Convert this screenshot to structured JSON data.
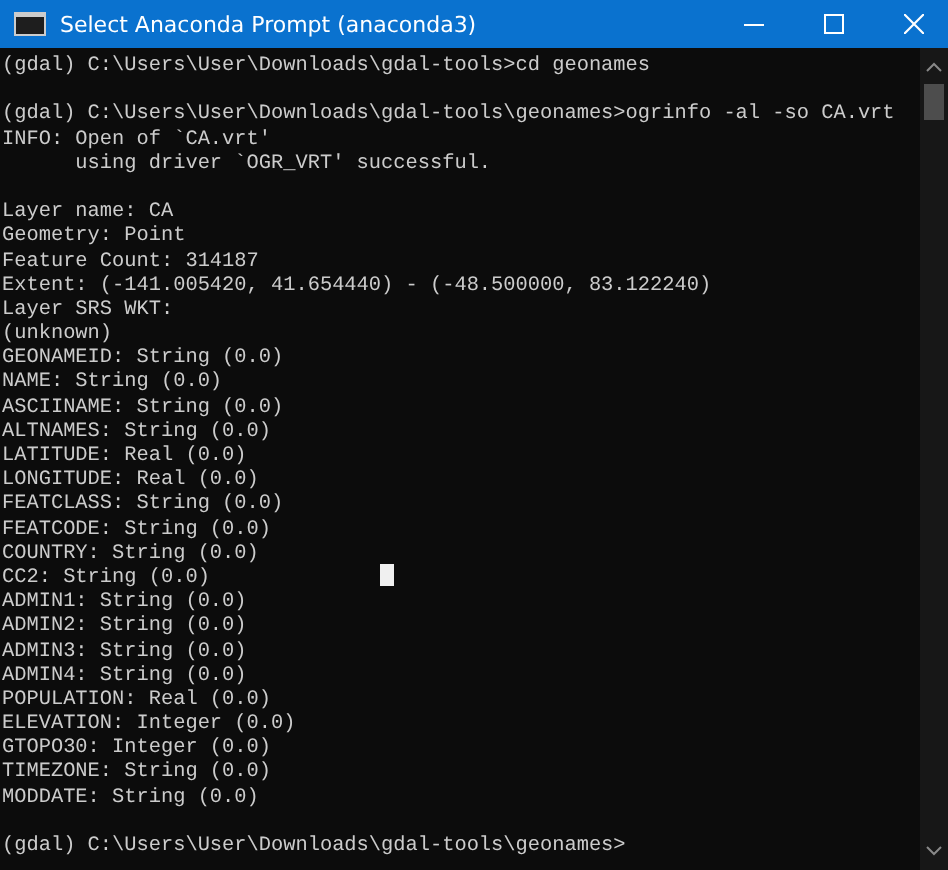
{
  "window": {
    "title": "Select Anaconda Prompt (anaconda3)"
  },
  "console": {
    "blocks": [
      {
        "lines": [
          "(gdal) C:\\Users\\User\\Downloads\\gdal-tools>cd geonames"
        ]
      },
      {
        "lines": [
          "(gdal) C:\\Users\\User\\Downloads\\gdal-tools\\geonames>ogrinfo -al -so CA.vrt",
          "INFO: Open of `CA.vrt'",
          "      using driver `OGR_VRT' successful."
        ]
      },
      {
        "lines": [
          "Layer name: CA",
          "Geometry: Point",
          "Feature Count: 314187",
          "Extent: (-141.005420, 41.654440) - (-48.500000, 83.122240)",
          "Layer SRS WKT:",
          "(unknown)",
          "GEONAMEID: String (0.0)",
          "NAME: String (0.0)",
          "ASCIINAME: String (0.0)",
          "ALTNAMES: String (0.0)",
          "LATITUDE: Real (0.0)",
          "LONGITUDE: Real (0.0)",
          "FEATCLASS: String (0.0)",
          "FEATCODE: String (0.0)",
          "COUNTRY: String (0.0)",
          "CC2: String (0.0)",
          "ADMIN1: String (0.0)",
          "ADMIN2: String (0.0)",
          "ADMIN3: String (0.0)",
          "ADMIN4: String (0.0)",
          "POPULATION: Real (0.0)",
          "ELEVATION: Integer (0.0)",
          "GTOPO30: Integer (0.0)",
          "TIMEZONE: String (0.0)",
          "MODDATE: String (0.0)"
        ]
      },
      {
        "lines": [
          "(gdal) C:\\Users\\User\\Downloads\\gdal-tools\\geonames>"
        ]
      }
    ],
    "cursor_shown": true
  }
}
